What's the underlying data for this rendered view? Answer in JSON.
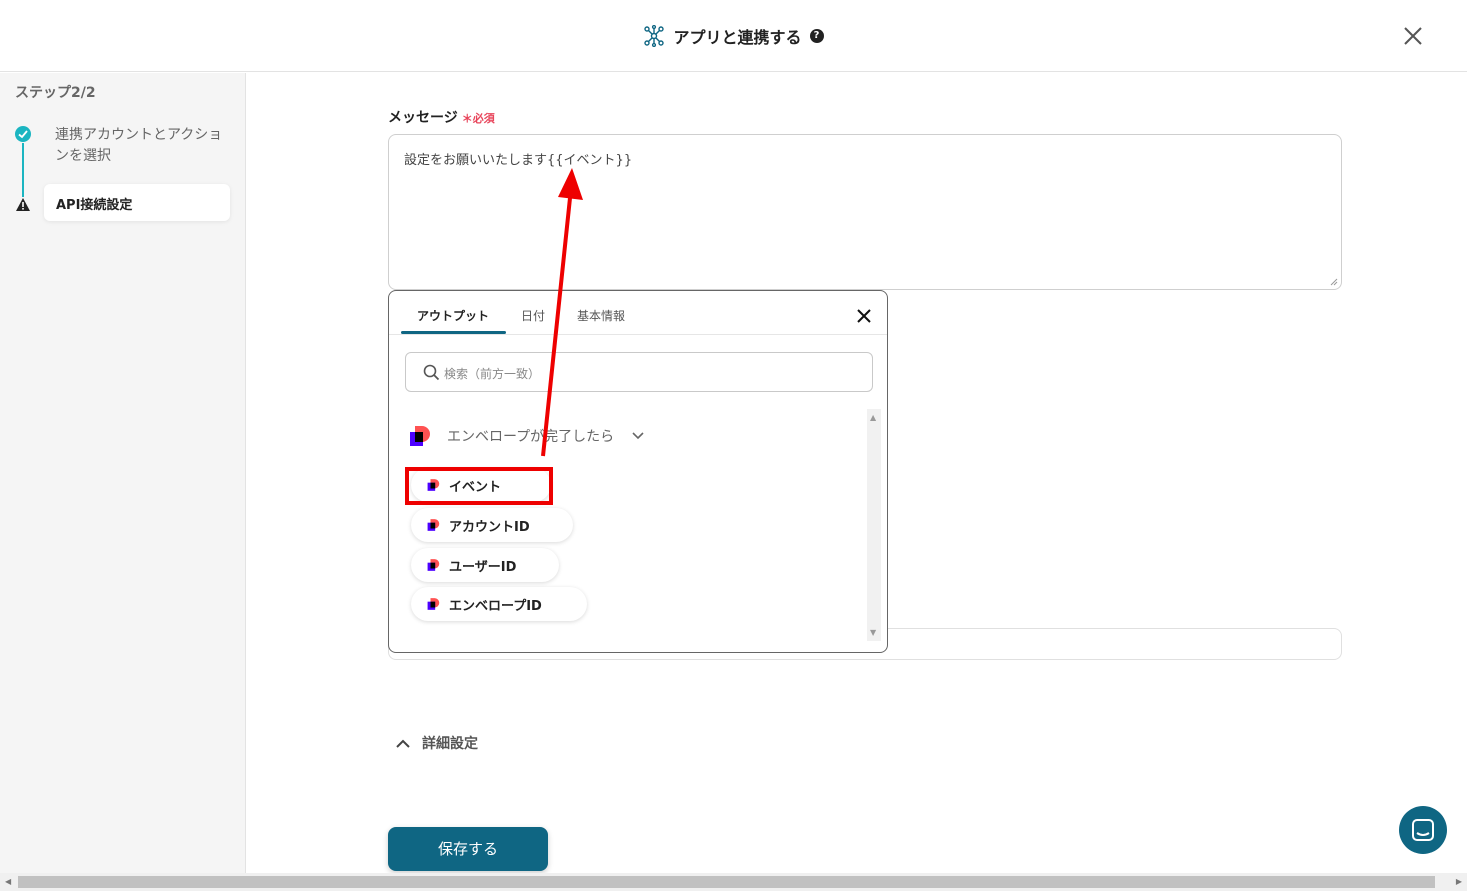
{
  "header": {
    "title": "アプリと連携する",
    "help": "?"
  },
  "sidebar": {
    "step_count": "ステップ2/2",
    "steps": [
      {
        "label": "連携アカウントとアクションを選択",
        "status": "done"
      },
      {
        "label": "API接続設定",
        "status": "warning"
      }
    ]
  },
  "message_field": {
    "label": "メッセージ",
    "required": "必須",
    "value": "設定をお願いいたします{{イベント}}"
  },
  "popup": {
    "tabs": [
      "アウトプット",
      "日付",
      "基本情報"
    ],
    "search_placeholder": "検索（前方一致）",
    "group_label": "エンベロープが完了したら",
    "items": [
      "イベント",
      "アカウントID",
      "ユーザーID",
      "エンベロープID"
    ]
  },
  "details_label": "詳細設定",
  "save_label": "保存する",
  "colors": {
    "accent": "#0f6683",
    "teal": "#1bb5c1",
    "required": "#e8455b",
    "highlight": "#ee0000"
  }
}
